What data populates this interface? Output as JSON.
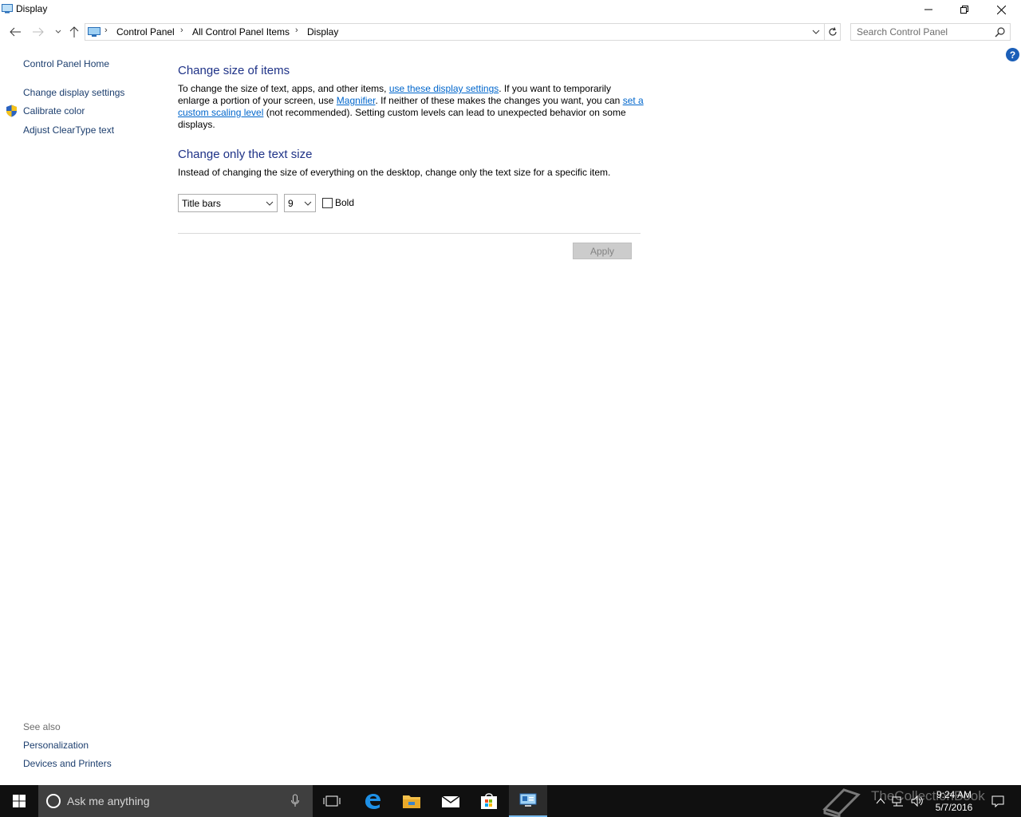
{
  "window": {
    "title": "Display",
    "minimize_icon": "minimize-icon",
    "restore_icon": "restore-icon",
    "close_icon": "close-icon"
  },
  "address_bar": {
    "breadcrumbs": [
      "Control Panel",
      "All Control Panel Items",
      "Display"
    ],
    "search_placeholder": "Search Control Panel"
  },
  "left_pane": {
    "home": "Control Panel Home",
    "links": [
      "Change display settings",
      "Calibrate color",
      "Adjust ClearType text"
    ],
    "see_also_label": "See also",
    "see_also": [
      "Personalization",
      "Devices and Printers"
    ]
  },
  "main": {
    "section1": {
      "heading": "Change size of items",
      "text_1": "To change the size of text, apps, and other items, ",
      "link_1": "use these display settings",
      "text_2": ".  If you want to temporarily enlarge a portion of your screen, use ",
      "link_2": "Magnifier",
      "text_3": ".  If neither of these makes the changes you want, you can ",
      "link_3": "set a custom scaling level",
      "text_4": " (not recommended).  Setting custom levels can lead to unexpected behavior on some displays."
    },
    "section2": {
      "heading": "Change only the text size",
      "description": "Instead of changing the size of everything on the desktop, change only the text size for a specific item.",
      "item_select_value": "Title bars",
      "size_select_value": "9",
      "bold_label": "Bold",
      "bold_checked": false
    },
    "apply_button": "Apply"
  },
  "taskbar": {
    "search_text": "Ask me anything",
    "time": "9:24 AM",
    "date": "5/7/2016",
    "watermark": "TheCollectionBook",
    "accent_color": "#76b9ed"
  }
}
